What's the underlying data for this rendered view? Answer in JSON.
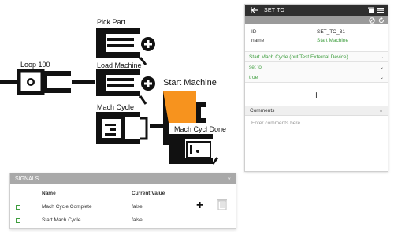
{
  "diagram": {
    "nodes": [
      {
        "id": "loop",
        "label": "Loop 100"
      },
      {
        "id": "pick",
        "label": "Pick Part"
      },
      {
        "id": "load",
        "label": "Load Machine"
      },
      {
        "id": "mach",
        "label": "Mach Cycle"
      },
      {
        "id": "start",
        "label": "Start Machine"
      },
      {
        "id": "done",
        "label": "Mach Cycl Done"
      }
    ],
    "accent_color": "#f7931e"
  },
  "set_to_panel": {
    "title": "SET TO",
    "properties": [
      {
        "key": "ID",
        "value": "SET_TO_31"
      },
      {
        "key": "name",
        "value": "Start Machine"
      }
    ],
    "selects": [
      "Start Mach Cycle (out/Test External Device)",
      "set to",
      "true"
    ],
    "add_symbol": "+",
    "comments_label": "Comments",
    "comments_placeholder": "Enter comments here."
  },
  "signals_panel": {
    "title": "SIGNALS",
    "close_symbol": "×",
    "columns": {
      "name": "Name",
      "value": "Current Value"
    },
    "rows": [
      {
        "name": "Mach Cycle Complete",
        "value": "false"
      },
      {
        "name": "Start Mach Cycle",
        "value": "false"
      }
    ],
    "add_symbol": "+"
  }
}
